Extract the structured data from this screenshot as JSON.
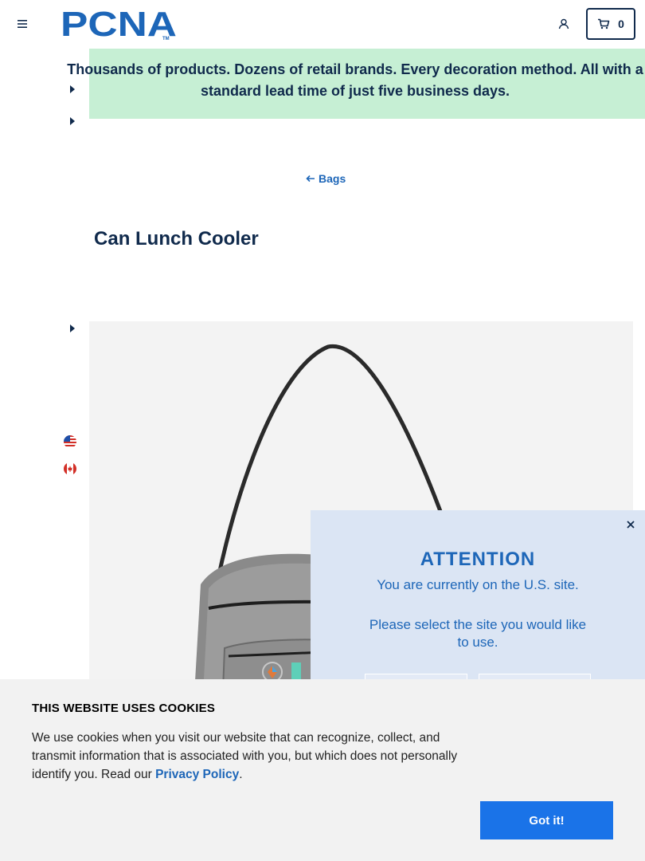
{
  "header": {
    "logo_text": "PCNA",
    "logo_tm": "TM",
    "cart_count": "0",
    "icons": {
      "menu": "hamburger-icon",
      "account": "user-icon",
      "cart": "cart-icon"
    }
  },
  "banner": {
    "text": "Thousands of products. Dozens of retail brands. Every decoration method. All with a standard lead time of just five business days.",
    "visible_text": "Thousands of products. Dozens of retail brands. Every decoration method. All with a standard lead time of just five business days.",
    "background": "#c6efd4"
  },
  "back_link": {
    "label": "Bags",
    "icon": "arrow-left-icon"
  },
  "product": {
    "title": "Can Lunch Cooler"
  },
  "side_nav": {
    "flags": [
      "us-flag-icon",
      "canada-flag-icon"
    ]
  },
  "attention": {
    "title": "ATTENTION",
    "message": "You are currently on the U.S. site.",
    "prompt": "Please select the site you would like to use."
  },
  "cookie": {
    "title": "THIS WEBSITE USES COOKIES",
    "text": "We use cookies when you visit our website that can recognize, collect, and transmit information that is associated with you, but which does not personally identify you. Read our ",
    "link_label": "Privacy Policy",
    "text_end": ".",
    "button_label": "Got it!"
  },
  "colors": {
    "brand_blue": "#1d66b8",
    "navy": "#102a4c",
    "cookie_button": "#1a73e8",
    "modal_bg": "#dbe5f4"
  }
}
